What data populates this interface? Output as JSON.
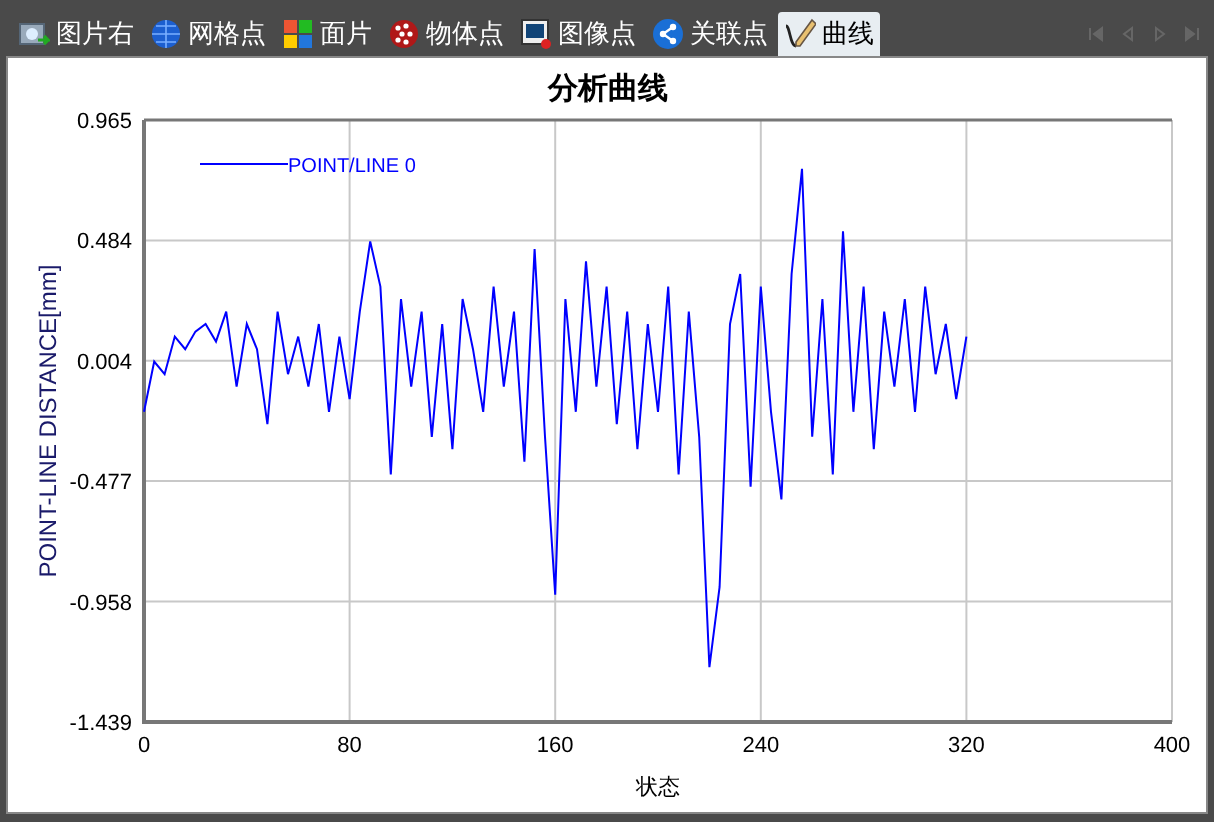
{
  "tabs": [
    {
      "label": "图片右",
      "kind": "photo",
      "selected": false
    },
    {
      "label": "网格点",
      "kind": "globe",
      "selected": false
    },
    {
      "label": "面片",
      "kind": "tiles",
      "selected": false
    },
    {
      "label": "物体点",
      "kind": "ball",
      "selected": false
    },
    {
      "label": "图像点",
      "kind": "image",
      "selected": false
    },
    {
      "label": "关联点",
      "kind": "share",
      "selected": false
    },
    {
      "label": "曲线",
      "kind": "curve",
      "selected": true
    }
  ],
  "chart": {
    "chart_data": {
      "type": "line",
      "grid": true,
      "title": "分析曲线",
      "xlabel": "状态",
      "ylabel": "POINT-LINE DISTANCE[mm]",
      "xlim": [
        0,
        400
      ],
      "ylim": [
        -1.439,
        0.965
      ],
      "xticks": [
        0,
        80,
        160,
        240,
        320,
        400
      ],
      "yticks": [
        0.965,
        0.484,
        0.004,
        -0.477,
        -0.958,
        -1.439
      ],
      "x": [
        0,
        4,
        8,
        12,
        16,
        20,
        24,
        28,
        32,
        36,
        40,
        44,
        48,
        52,
        56,
        60,
        64,
        68,
        72,
        76,
        80,
        84,
        88,
        92,
        96,
        100,
        104,
        108,
        112,
        116,
        120,
        124,
        128,
        132,
        136,
        140,
        144,
        148,
        152,
        156,
        160,
        164,
        168,
        172,
        176,
        180,
        184,
        188,
        192,
        196,
        200,
        204,
        208,
        212,
        216,
        220,
        224,
        228,
        232,
        236,
        240,
        244,
        248,
        252,
        256,
        260,
        264,
        268,
        272,
        276,
        280,
        284,
        288,
        292,
        296,
        300,
        304,
        308,
        312,
        316,
        320
      ],
      "series": [
        {
          "name": "POINT/LINE 0",
          "color": "#0000ff",
          "values": [
            -0.2,
            0.0,
            -0.05,
            0.1,
            0.05,
            0.12,
            0.15,
            0.08,
            0.2,
            -0.1,
            0.15,
            0.05,
            -0.25,
            0.2,
            -0.05,
            0.1,
            -0.1,
            0.15,
            -0.2,
            0.1,
            -0.15,
            0.2,
            0.48,
            0.3,
            -0.45,
            0.25,
            -0.1,
            0.2,
            -0.3,
            0.15,
            -0.35,
            0.25,
            0.05,
            -0.2,
            0.3,
            -0.1,
            0.2,
            -0.4,
            0.45,
            -0.3,
            -0.93,
            0.25,
            -0.2,
            0.4,
            -0.1,
            0.3,
            -0.25,
            0.2,
            -0.35,
            0.15,
            -0.2,
            0.3,
            -0.45,
            0.2,
            -0.3,
            -1.22,
            -0.9,
            0.15,
            0.35,
            -0.5,
            0.3,
            -0.2,
            -0.55,
            0.35,
            0.77,
            -0.3,
            0.25,
            -0.45,
            0.52,
            -0.2,
            0.3,
            -0.35,
            0.2,
            -0.1,
            0.25,
            -0.2,
            0.3,
            -0.05,
            0.15,
            -0.15,
            0.1
          ]
        }
      ]
    }
  }
}
